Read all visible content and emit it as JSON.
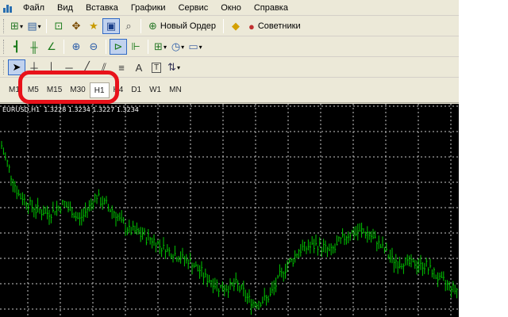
{
  "menu": {
    "items": [
      "Файл",
      "Вид",
      "Вставка",
      "Графики",
      "Сервис",
      "Окно",
      "Справка"
    ]
  },
  "toolbar_main": {
    "new_order_label": "Новый Ордер",
    "experts_label": "Советники"
  },
  "toolbar_objects": {
    "text_tool": "A",
    "text_label_tool": "T"
  },
  "timeframes": {
    "items": [
      "M1",
      "M5",
      "M15",
      "M30",
      "H1",
      "H4",
      "D1",
      "W1",
      "MN"
    ],
    "selected": "H1"
  },
  "chart": {
    "title": "EURUSD,H1  1.3228 1.3234 1.3227 1.3234",
    "symbol": "EURUSD",
    "timeframe": "H1",
    "bar_color": "#00c800",
    "background_color": "#000000",
    "grid": true
  },
  "chart_data": {
    "type": "ohlc",
    "symbol": "EURUSD",
    "timeframe": "H1",
    "last_bar": {
      "open": 1.3228,
      "high": 1.3234,
      "low": 1.3227,
      "close": 1.3234
    },
    "relative_close_path": [
      0.86,
      0.62,
      0.54,
      0.51,
      0.56,
      0.48,
      0.6,
      0.53,
      0.43,
      0.4,
      0.35,
      0.3,
      0.26,
      0.18,
      0.12,
      0.14,
      0.04,
      0.07,
      0.22,
      0.32,
      0.35,
      0.31,
      0.4,
      0.42,
      0.36,
      0.26,
      0.25,
      0.24,
      0.16,
      0.11
    ]
  },
  "colors": {
    "highlight": "#e8121a",
    "toolbar_bg": "#ece9d8",
    "active_button": "#c1d2ee"
  }
}
